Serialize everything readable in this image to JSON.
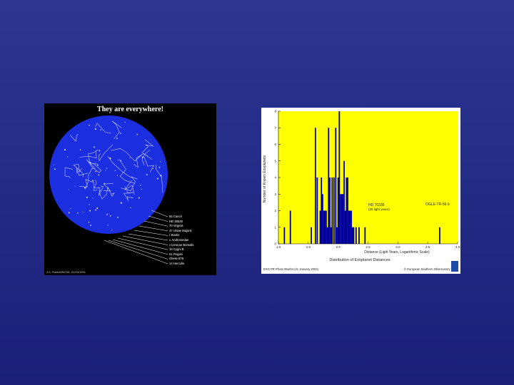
{
  "sky_map": {
    "title": "They are everywhere!",
    "credit": "J.C. Kunkel/NCSA, 01/10/1991",
    "legend": [
      "55 Cancri",
      "HD 38529",
      "70 Virginis",
      "47 Ursae Majoris",
      "τ Bootis",
      "υ Andromedae",
      "ι Coronae Borealis",
      "16 Cygni B",
      "51 Pegasi",
      "Gliese 876",
      "14 Herculis"
    ]
  },
  "histogram": {
    "footer_left": "ESO PR Photo 06a/04 (21 January 2004)",
    "footer_right": "© European Southern Observatory",
    "annotations": {
      "hd": "HD 70335",
      "hd_sub": "(25 light years)",
      "ogle": "OGLE-TR-56 b"
    }
  },
  "colors": {
    "background": "#2a3290",
    "plot_bg": "#ffff00",
    "bar": "#0000a0",
    "sky_disk": "#1c2fe0"
  },
  "chart_data": {
    "type": "bar",
    "title": "Distribution of Exoplanet Distances",
    "xlabel": "Distance (Light Years, Logarithmic Scale)",
    "ylabel": "Number of Known Exoplanets",
    "xlim": [
      1.0,
      4.0
    ],
    "ylim": [
      0,
      8
    ],
    "xticks": [
      "1.0",
      "1.5",
      "2.0",
      "2.5",
      "3.0",
      "3.5",
      "4.0"
    ],
    "yticks": [
      "0",
      "1",
      "2",
      "3",
      "4",
      "5",
      "6",
      "7",
      "8"
    ],
    "x": [
      1.1,
      1.2,
      1.55,
      1.62,
      1.65,
      1.7,
      1.72,
      1.74,
      1.76,
      1.78,
      1.8,
      1.82,
      1.84,
      1.86,
      1.88,
      1.9,
      1.93,
      1.96,
      1.98,
      2.0,
      2.02,
      2.04,
      2.06,
      2.08,
      2.1,
      2.12,
      2.14,
      2.16,
      2.18,
      2.2,
      2.22,
      2.24,
      2.26,
      2.3,
      2.35,
      2.45,
      3.7
    ],
    "values": [
      1,
      2,
      1,
      7,
      4,
      2,
      4,
      3,
      2,
      2,
      2,
      1,
      7,
      4,
      1,
      4,
      4,
      7,
      1,
      4,
      8,
      3,
      3,
      3,
      5,
      2,
      4,
      4,
      2,
      2,
      2,
      1,
      1,
      1,
      1,
      1,
      1
    ]
  }
}
